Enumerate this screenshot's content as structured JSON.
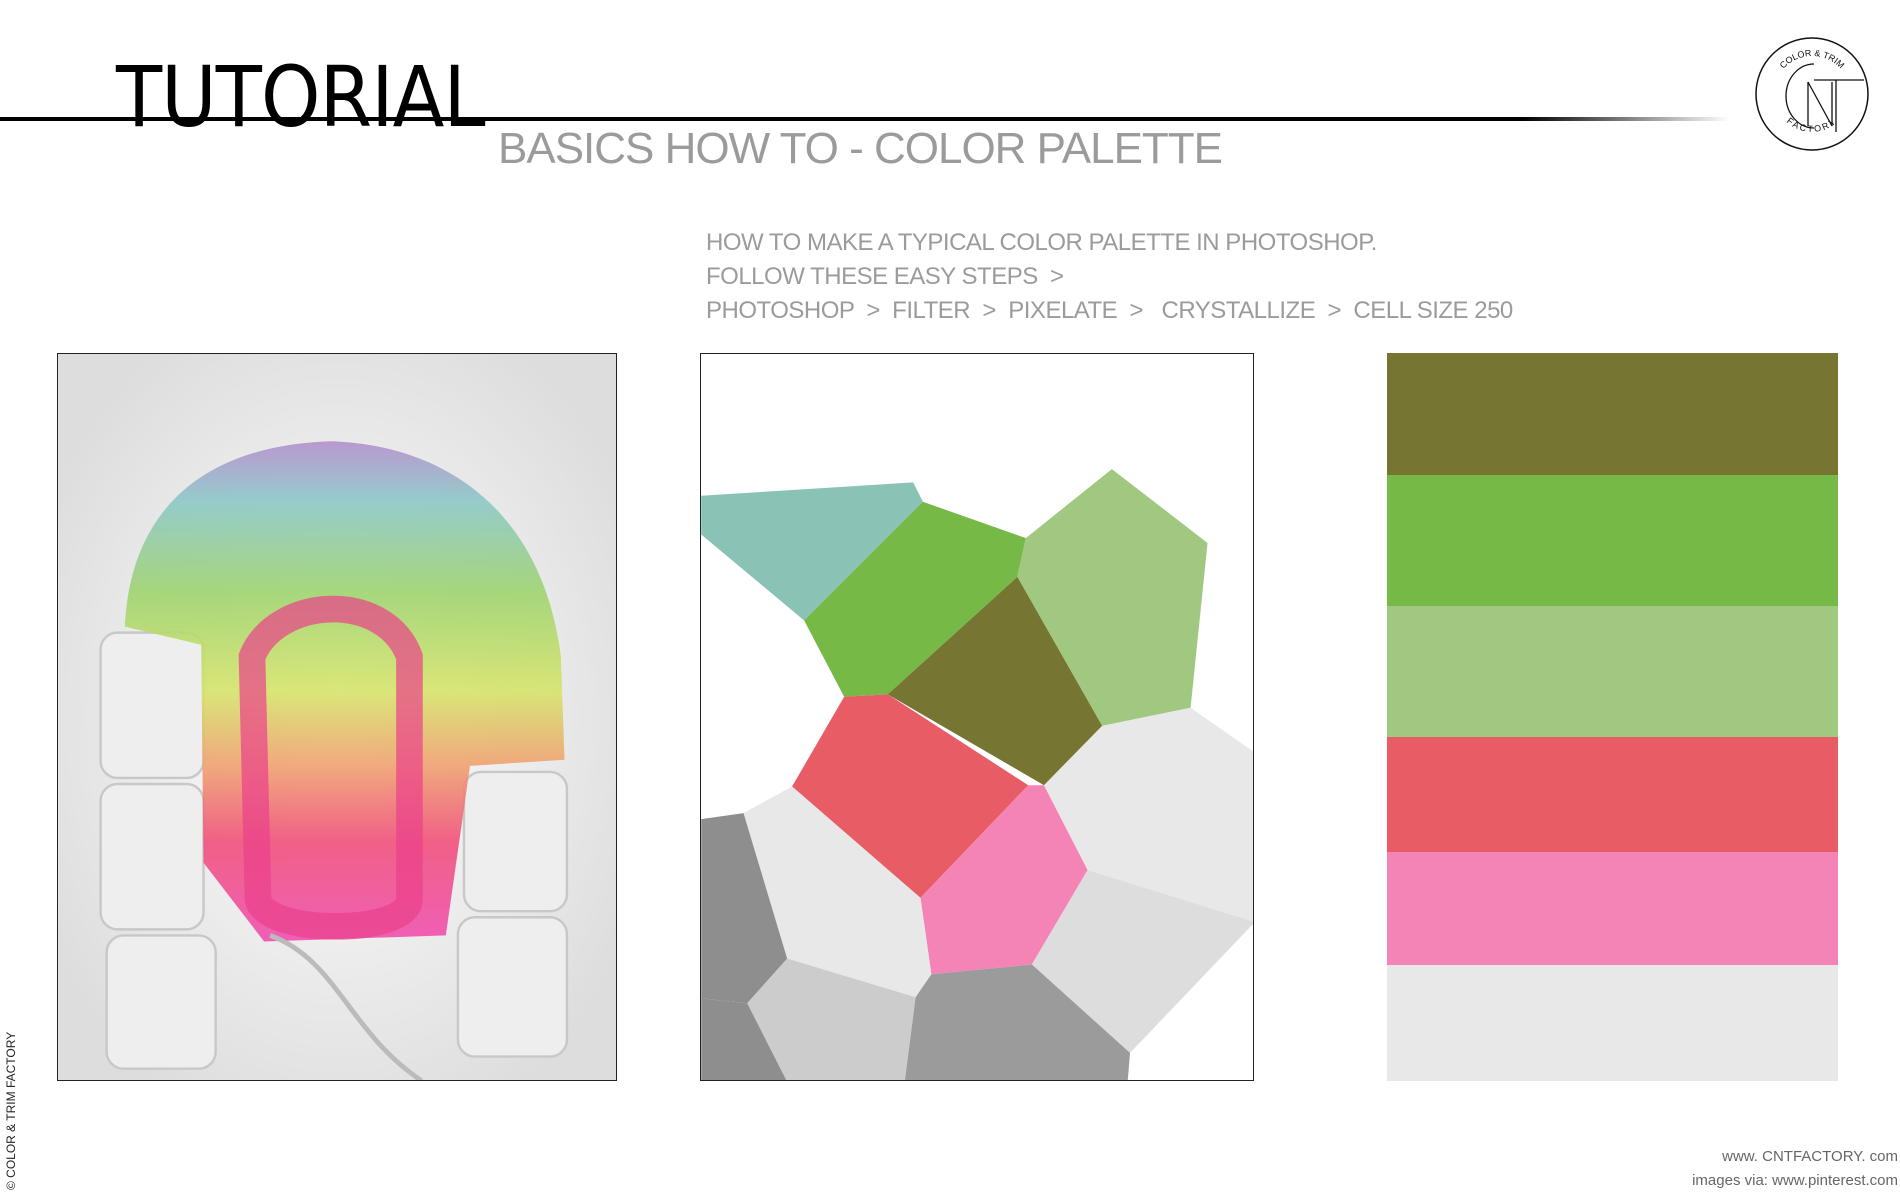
{
  "header": {
    "title": "TUTORIAL",
    "subtitle": "BASICS HOW TO - COLOR PALETTE"
  },
  "instructions": [
    "HOW TO MAKE A TYPICAL COLOR PALETTE IN PHOTOSHOP.",
    "FOLLOW THESE EASY STEPS  >",
    "PHOTOSHOP  >  FILTER  >  PIXELATE  >   CRYSTALLIZE  >  CELL SIZE 250"
  ],
  "logo": {
    "text_top": "COLOR & TRIM",
    "text_bottom": "FACTORY",
    "monogram": "CNT"
  },
  "palette": {
    "colors": [
      "#767532",
      "#76b947",
      "#a0c880",
      "#e85d65",
      "#f584b6",
      "#e8e8e8"
    ]
  },
  "crystallize_colors": {
    "teal": "#8bc2b6",
    "green": "#76b947",
    "light_green": "#a0c880",
    "olive": "#767532",
    "red": "#e85d65",
    "pink": "#f584b6",
    "light_gray": "#e8e8e8",
    "gray": "#dddddd",
    "mid_gray": "#cccccc",
    "dark_gray": "#9b9b9b",
    "darker_gray": "#8e8e8e"
  },
  "footer": {
    "website": "www. CNTFACTORY. com",
    "credit": "images via: www.pinterest.com",
    "copyright": "© COLOR & TRIM FACTORY"
  }
}
